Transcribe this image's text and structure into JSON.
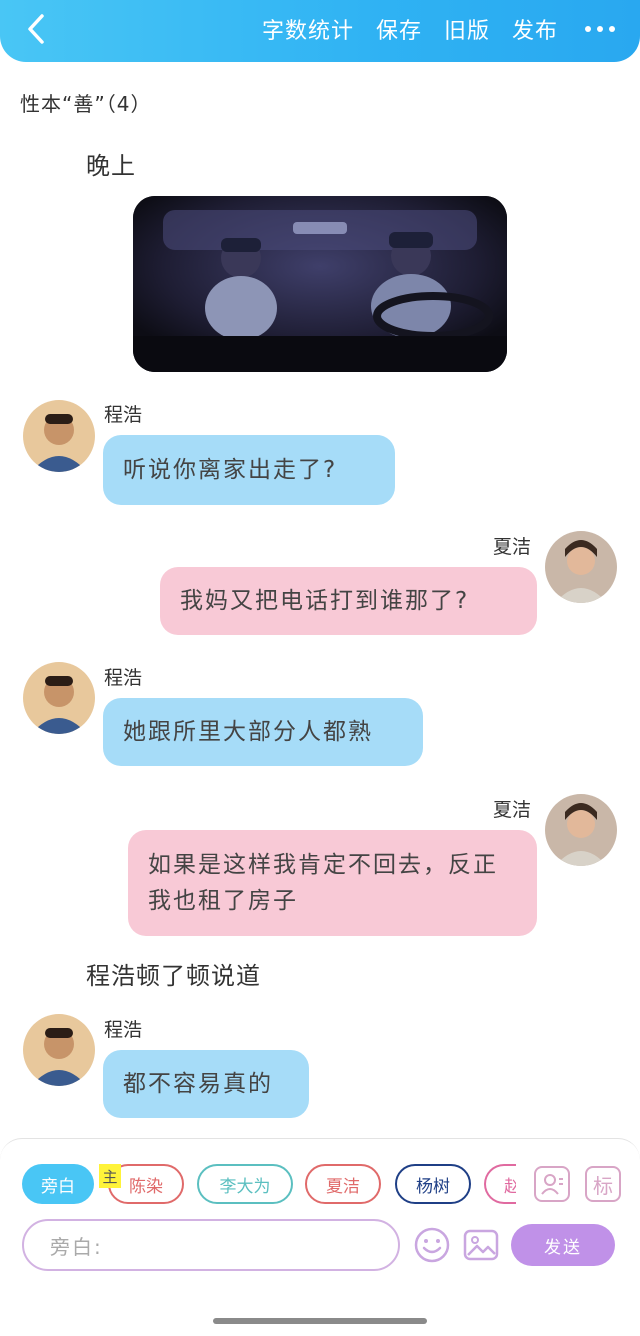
{
  "header": {
    "actions": [
      "字数统计",
      "保存",
      "旧版",
      "发布"
    ]
  },
  "story": {
    "title": "性本“善”（4）"
  },
  "messages": [
    {
      "type": "narration",
      "text": "晚上"
    },
    {
      "type": "image",
      "icon": "car-scene-image"
    },
    {
      "type": "left",
      "name": "程浩",
      "text": "听说你离家出走了?"
    },
    {
      "type": "right",
      "name": "夏洁",
      "text": "我妈又把电话打到谁那了?"
    },
    {
      "type": "left",
      "name": "程浩",
      "text": "她跟所里大部分人都熟"
    },
    {
      "type": "right",
      "name": "夏洁",
      "text": "如果是这样我肯定不回去，反正我也租了房子"
    },
    {
      "type": "narration",
      "text": "程浩顿了顿说道"
    },
    {
      "type": "left",
      "name": "程浩",
      "text": "都不容易真的"
    }
  ],
  "roles": [
    {
      "label": "旁白",
      "active": true,
      "color": "#49c6f5"
    },
    {
      "label": "陈染",
      "color": "#e06a6a"
    },
    {
      "label": "李大为",
      "color": "#5bbfc0"
    },
    {
      "label": "夏洁",
      "color": "#e06a6a"
    },
    {
      "label": "杨树",
      "color": "#1f3f86"
    },
    {
      "label": "赵",
      "color": "#e06aa0"
    }
  ],
  "main_tag": "主",
  "side_buttons": {
    "role_icon": "role-card-icon",
    "mark_label": "标"
  },
  "composer": {
    "placeholder": "旁白:",
    "send_label": "发送"
  },
  "colors": {
    "accent": "#2fb2f3",
    "left_bubble": "#a6dcf8",
    "right_bubble": "#f8c9d6",
    "send": "#c091e8"
  }
}
